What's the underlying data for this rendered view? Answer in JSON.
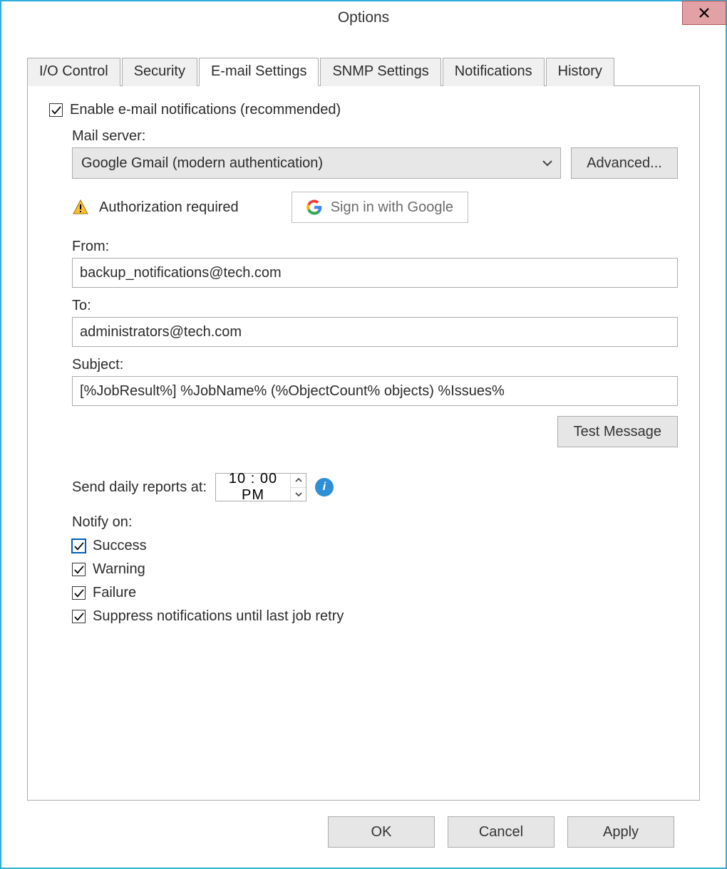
{
  "window": {
    "title": "Options"
  },
  "tabs": {
    "io": {
      "label": "I/O Control"
    },
    "security": {
      "label": "Security"
    },
    "email": {
      "label": "E-mail Settings"
    },
    "snmp": {
      "label": "SNMP Settings"
    },
    "notif": {
      "label": "Notifications"
    },
    "history": {
      "label": "History"
    }
  },
  "email": {
    "enable_label": "Enable e-mail notifications (recommended)",
    "mail_server_label": "Mail server:",
    "mail_server_value": "Google Gmail (modern authentication)",
    "advanced_btn": "Advanced...",
    "auth_required": "Authorization required",
    "google_btn": "Sign in with Google",
    "from_label": "From:",
    "from_value": "backup_notifications@tech.com",
    "to_label": "To:",
    "to_value": "administrators@tech.com",
    "subject_label": "Subject:",
    "subject_value": "[%JobResult%] %JobName% (%ObjectCount% objects) %Issues%",
    "test_btn": "Test Message",
    "daily_label": "Send daily reports at:",
    "daily_time": "10 : 00 PM",
    "notify_on_label": "Notify on:",
    "notify_success": "Success",
    "notify_warning": "Warning",
    "notify_failure": "Failure",
    "notify_suppress": "Suppress notifications until last job retry"
  },
  "buttons": {
    "ok": "OK",
    "cancel": "Cancel",
    "apply": "Apply"
  }
}
